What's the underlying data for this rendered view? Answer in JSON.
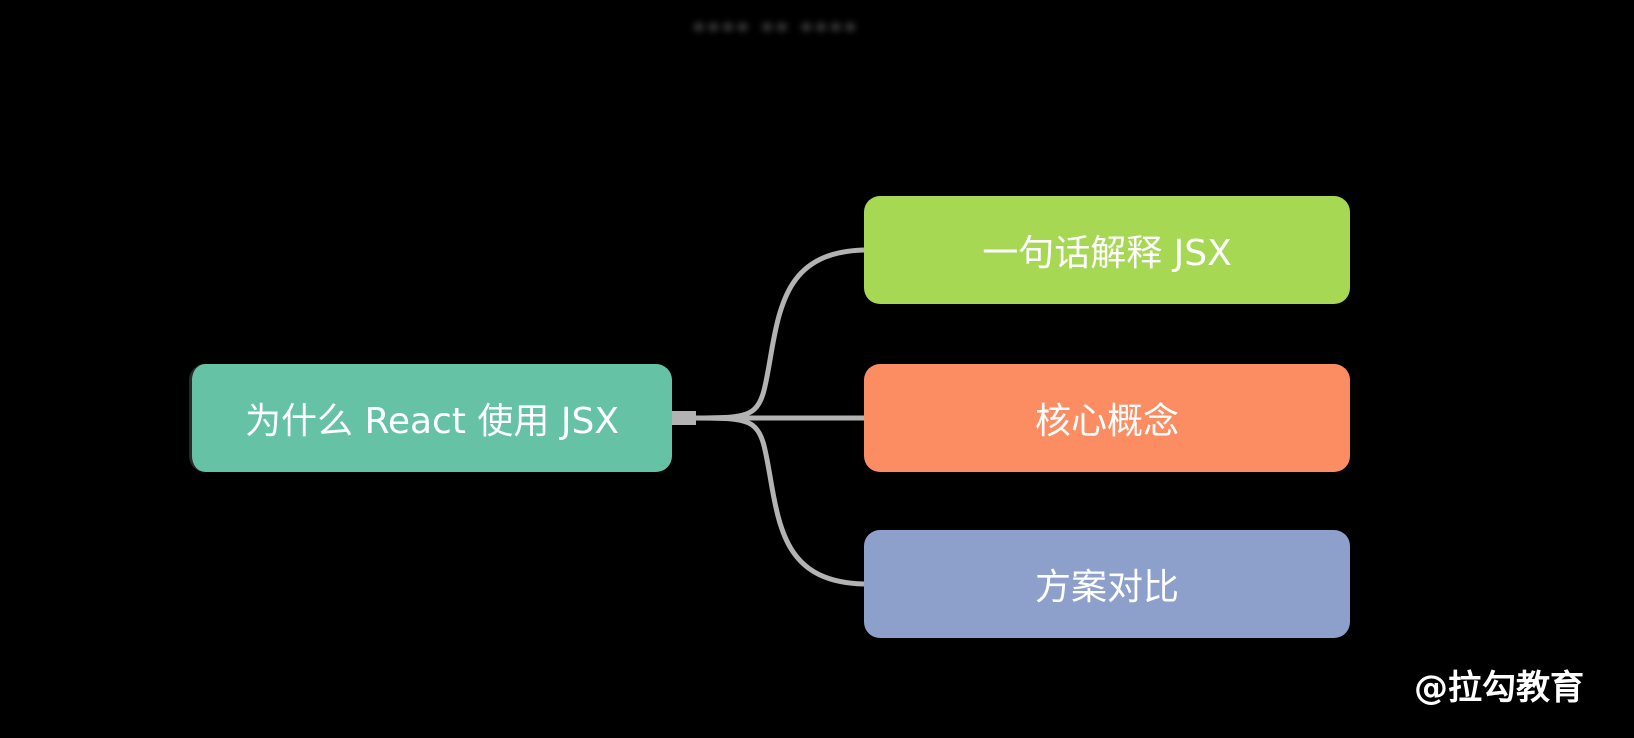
{
  "title": "**** ** ****",
  "root": {
    "label": "为什么 React 使用 JSX",
    "color": "#66c2a5"
  },
  "children": [
    {
      "label": "一句话解释 JSX",
      "color": "#a6d854"
    },
    {
      "label": "核心概念",
      "color": "#fc8d62"
    },
    {
      "label": "方案对比",
      "color": "#8da0cb"
    }
  ],
  "connector_color": "#b3b3b3",
  "watermark": "@拉勾教育"
}
